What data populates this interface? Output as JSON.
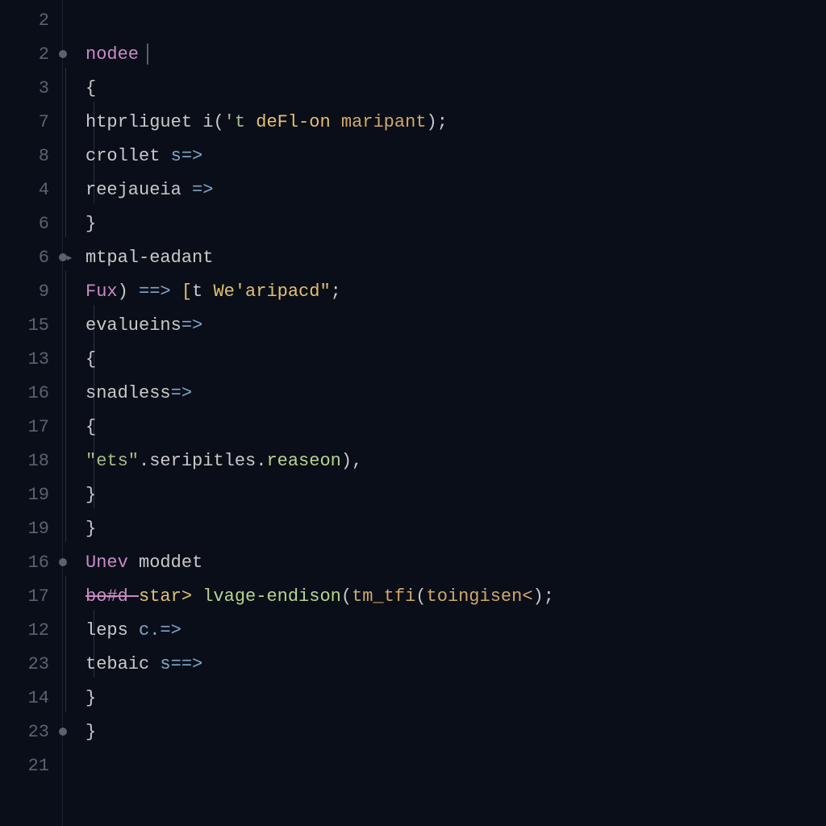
{
  "gutter": {
    "rows": [
      {
        "n": "2",
        "fold": ""
      },
      {
        "n": "2",
        "fold": "dot"
      },
      {
        "n": "3",
        "fold": ""
      },
      {
        "n": "7",
        "fold": ""
      },
      {
        "n": "8",
        "fold": ""
      },
      {
        "n": "4",
        "fold": ""
      },
      {
        "n": "6",
        "fold": ""
      },
      {
        "n": "6",
        "fold": "dotchev"
      },
      {
        "n": "9",
        "fold": ""
      },
      {
        "n": "15",
        "fold": ""
      },
      {
        "n": "13",
        "fold": ""
      },
      {
        "n": "16",
        "fold": ""
      },
      {
        "n": "17",
        "fold": ""
      },
      {
        "n": "18",
        "fold": ""
      },
      {
        "n": "19",
        "fold": ""
      },
      {
        "n": "19",
        "fold": ""
      },
      {
        "n": "16",
        "fold": "dot"
      },
      {
        "n": "17",
        "fold": ""
      },
      {
        "n": "12",
        "fold": ""
      },
      {
        "n": "23",
        "fold": ""
      },
      {
        "n": "14",
        "fold": ""
      },
      {
        "n": "23",
        "fold": "dot"
      },
      {
        "n": "21",
        "fold": ""
      }
    ]
  },
  "code": {
    "l1": "",
    "l2_kw": "nodee",
    "l3": "{",
    "l4_a": "htprliguet",
    "l4_b": " i",
    "l4_c": "(",
    "l4_d": "'t ",
    "l4_e": "deFl-on ",
    "l4_f": "maripant",
    "l4_g": ");",
    "l5_a": "crollet",
    "l5_b": " s=>",
    "l6_a": "reejaueia",
    "l6_b": " =>",
    "l7": "}",
    "l8_a": "mtpal-eadant",
    "l9_a": "Fux",
    "l9_b": ")",
    "l9_c": " ==> ",
    "l9_d": "[",
    "l9_e": "t ",
    "l9_f": "We'aripacd\"",
    "l9_g": ";",
    "l10_a": "evalueins",
    "l10_b": "=>",
    "l11": "{",
    "l12_a": "snadless",
    "l12_b": "=>",
    "l13": "{",
    "l14_a": "\"ets\"",
    "l14_b": ".seripitles.",
    "l14_c": "reaseon",
    "l14_d": "),",
    "l15": "}",
    "l16": "}",
    "l17_a": "Unev ",
    "l17_b": "moddet",
    "l18_a": "bo#d ",
    "l18_b": "star> ",
    "l18_c": "lvage-endison",
    "l18_d": "(",
    "l18_e": "tm_tfi",
    "l18_f": "(",
    "l18_g": "toingisen<",
    "l18_h": ");",
    "l19_a": "leps",
    "l19_b": " c.=>",
    "l20_a": "tebaic",
    "l20_b": " s==>",
    "l21": "}",
    "l22": "}",
    "l23": ""
  }
}
